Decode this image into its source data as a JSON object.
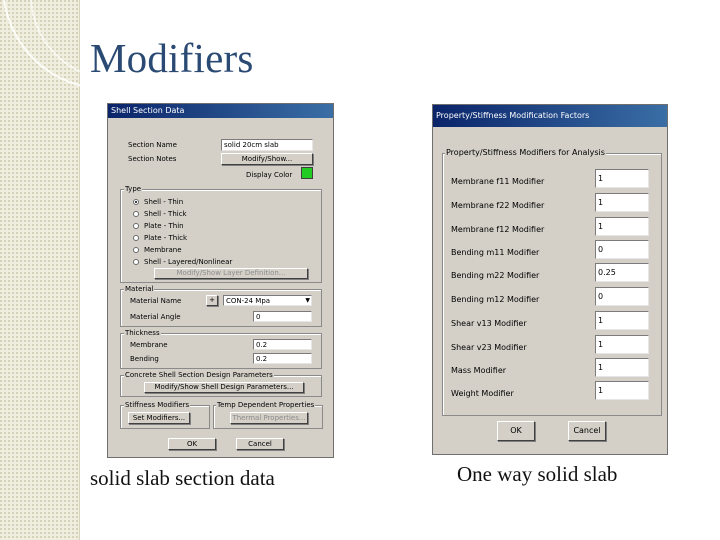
{
  "slide": {
    "title": "Modifiers",
    "caption_left": "solid slab section data",
    "caption_right": "One way solid slab"
  },
  "shell_dialog": {
    "title": "Shell Section Data",
    "section_name_label": "Section Name",
    "section_name_value": "solid 20cm slab",
    "section_notes_label": "Section Notes",
    "modify_show_button": "Modify/Show...",
    "display_color_label": "Display Color",
    "display_color": "#22cc22",
    "type_group": "Type",
    "type_options": [
      "Shell - Thin",
      "Shell - Thick",
      "Plate - Thin",
      "Plate - Thick",
      "Membrane",
      "Shell - Layered/Nonlinear"
    ],
    "type_selected": "Shell - Thin",
    "layer_button": "Modify/Show Layer Definition...",
    "material_group": "Material",
    "material_name_label": "Material Name",
    "material_value": "CON-24 Mpa",
    "material_angle_label": "Material Angle",
    "material_angle_value": "0",
    "thickness_group": "Thickness",
    "membrane_label": "Membrane",
    "membrane_value": "0.2",
    "bending_label": "Bending",
    "bending_value": "0.2",
    "concrete_group": "Concrete Shell Section Design Parameters",
    "design_button": "Modify/Show Shell Design Parameters...",
    "stiffness_group": "Stiffness Modifiers",
    "set_modifiers_button": "Set Modifiers...",
    "temp_group": "Temp Dependent Properties",
    "thermal_button": "Thermal Properties...",
    "ok_button": "OK",
    "cancel_button": "Cancel"
  },
  "modifier_dialog": {
    "title": "Property/Stiffness Modification Factors",
    "group_label": "Property/Stiffness Modifiers for Analysis",
    "rows": [
      {
        "label": "Membrane f11 Modifier",
        "value": "1"
      },
      {
        "label": "Membrane f22 Modifier",
        "value": "1"
      },
      {
        "label": "Membrane f12 Modifier",
        "value": "1"
      },
      {
        "label": "Bending m11 Modifier",
        "value": "0"
      },
      {
        "label": "Bending m22 Modifier",
        "value": "0.25"
      },
      {
        "label": "Bending m12 Modifier",
        "value": "0"
      },
      {
        "label": "Shear v13 Modifier",
        "value": "1"
      },
      {
        "label": "Shear v23 Modifier",
        "value": "1"
      },
      {
        "label": "Mass Modifier",
        "value": "1"
      },
      {
        "label": "Weight Modifier",
        "value": "1"
      }
    ],
    "ok_button": "OK",
    "cancel_button": "Cancel"
  }
}
